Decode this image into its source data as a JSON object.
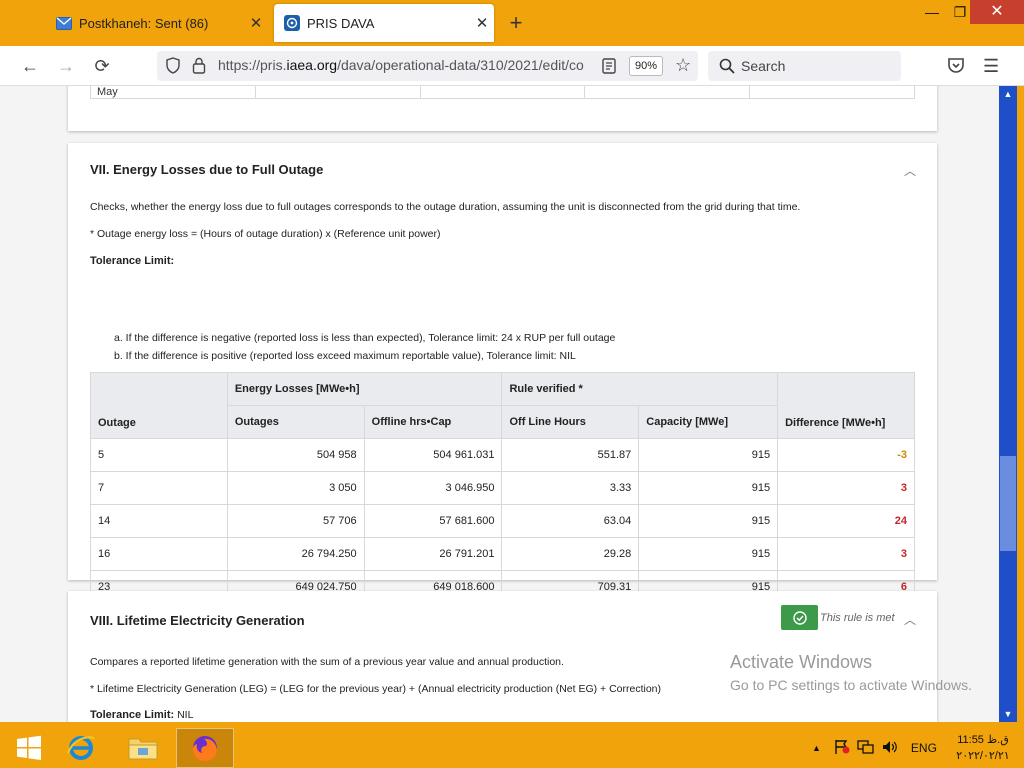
{
  "browser": {
    "tabs": [
      {
        "label": "Postkhaneh: Sent (86)"
      },
      {
        "label": "PRIS DAVA"
      }
    ],
    "url_prefix": "https://pris.",
    "url_domain": "iaea.org",
    "url_path": "/dava/operational-data/310/2021/edit/co",
    "zoom": "90%",
    "search_placeholder": "Search"
  },
  "prev_table": {
    "row": [
      "May",
      "",
      "",
      "",
      ""
    ]
  },
  "section7": {
    "title": "VII. Energy Losses due to Full Outage",
    "desc": "Checks, whether the energy loss due to full outages corresponds to the outage duration, assuming the unit is disconnected from the grid during that time.",
    "formula": "* Outage energy loss = (Hours of outage duration) x (Reference unit power)",
    "tolerance_label": "Tolerance Limit:",
    "tolerance_a": "a. If the difference is negative (reported loss is less than expected), Tolerance limit: 24 x RUP per full outage",
    "tolerance_b": "b. If the difference is positive (reported loss exceed maximum reportable value), Tolerance limit: NIL",
    "table": {
      "group_energy": "Energy Losses [MWe•h]",
      "group_rule": "Rule verified *",
      "col_outage": "Outage",
      "col_outages": "Outages",
      "col_offline": "Offline hrs•Cap",
      "col_offhours": "Off Line Hours",
      "col_capacity": "Capacity [MWe]",
      "col_difference": "Difference [MWe•h]",
      "rows": [
        {
          "outage": "5",
          "outages": "504 958",
          "offline": "504 961.031",
          "offhours": "551.87",
          "capacity": "915",
          "difference": "-3"
        },
        {
          "outage": "7",
          "outages": "3 050",
          "offline": "3 046.950",
          "offhours": "3.33",
          "capacity": "915",
          "difference": "3"
        },
        {
          "outage": "14",
          "outages": "57 706",
          "offline": "57 681.600",
          "offhours": "63.04",
          "capacity": "915",
          "difference": "24"
        },
        {
          "outage": "16",
          "outages": "26 794.250",
          "offline": "26 791.201",
          "offhours": "29.28",
          "capacity": "915",
          "difference": "3"
        },
        {
          "outage": "23",
          "outages": "649 024.750",
          "offline": "649 018.600",
          "offhours": "709.31",
          "capacity": "915",
          "difference": "6"
        }
      ]
    }
  },
  "section8": {
    "title": "VIII. Lifetime Electricity Generation",
    "status": "This rule is met",
    "desc": "Compares a reported lifetime generation with the sum of a previous year value and annual production.",
    "formula": "* Lifetime Electricity Generation (LEG) = (LEG for the previous year) + (Annual electricity production (Net EG) + Correction)",
    "tolerance_label": "Tolerance Limit:",
    "tolerance_value": "NIL"
  },
  "watermark": {
    "line1": "Activate Windows",
    "line2": "Go to PC settings to activate Windows."
  },
  "taskbar": {
    "language": "ENG",
    "time": "ق.ظ 11:55",
    "date": "۲۰۲۲/۰۲/۲۱"
  },
  "colors": {
    "difference_negative": "#c98d00",
    "difference_positive": "#c0282c",
    "rule_met": "#3c9a48"
  }
}
